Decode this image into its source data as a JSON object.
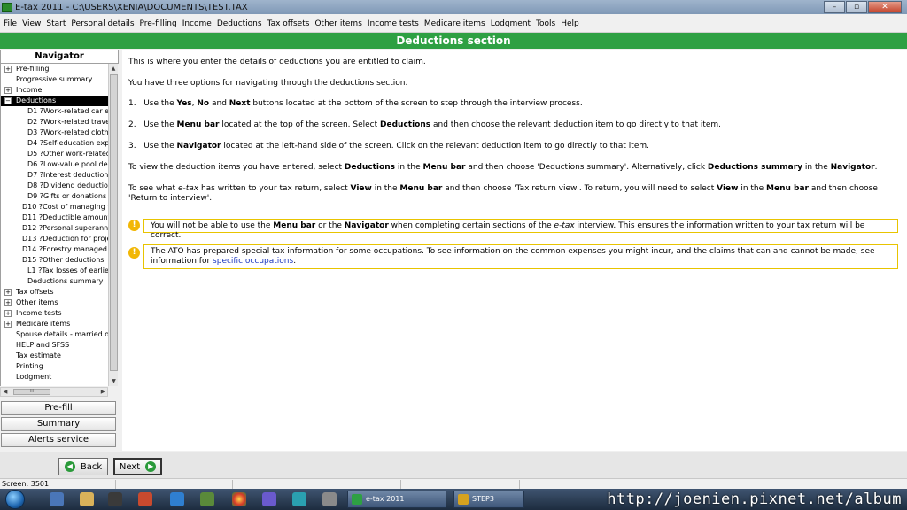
{
  "window": {
    "title": "E-tax 2011 - C:\\USERS\\XENIA\\DOCUMENTS\\TEST.TAX",
    "minimize": "–",
    "maximize": "▫",
    "close": "✕"
  },
  "menu": [
    "File",
    "View",
    "Start",
    "Personal details",
    "Pre-filling",
    "Income",
    "Deductions",
    "Tax offsets",
    "Other items",
    "Income tests",
    "Medicare items",
    "Lodgment",
    "Tools",
    "Help"
  ],
  "section": {
    "title": "Deductions section"
  },
  "navigator": {
    "title": "Navigator",
    "items": [
      {
        "label": "Pre-filling",
        "expander": "+"
      },
      {
        "label": "Progressive summary",
        "expander": ""
      },
      {
        "label": "Income",
        "expander": "+"
      },
      {
        "label": "Deductions",
        "expander": "−",
        "selected": true
      },
      {
        "label": "D1 ?Work-related car exp",
        "expander": ""
      },
      {
        "label": "D2 ?Work-related travel e",
        "expander": ""
      },
      {
        "label": "D3 ?Work-related clothing",
        "expander": ""
      },
      {
        "label": "D4 ?Self-education exper",
        "expander": ""
      },
      {
        "label": "D5 ?Other work-related e",
        "expander": ""
      },
      {
        "label": "D6 ?Low-value pool dedu",
        "expander": ""
      },
      {
        "label": "D7 ?Interest deductions",
        "expander": ""
      },
      {
        "label": "D8 ?Dividend deductions",
        "expander": ""
      },
      {
        "label": "D9 ?Gifts or donations",
        "expander": ""
      },
      {
        "label": "D10 ?Cost of managing tax",
        "expander": ""
      },
      {
        "label": "D11 ?Deductible amount o",
        "expander": ""
      },
      {
        "label": "D12 ?Personal superannu",
        "expander": ""
      },
      {
        "label": "D13 ?Deduction for project",
        "expander": ""
      },
      {
        "label": "D14 ?Forestry managed in",
        "expander": ""
      },
      {
        "label": "D15 ?Other deductions",
        "expander": ""
      },
      {
        "label": "L1 ?Tax losses of earlier",
        "expander": ""
      },
      {
        "label": "Deductions summary",
        "expander": ""
      },
      {
        "label": "Tax offsets",
        "expander": "+"
      },
      {
        "label": "Other items",
        "expander": "+"
      },
      {
        "label": "Income tests",
        "expander": "+"
      },
      {
        "label": "Medicare items",
        "expander": "+"
      },
      {
        "label": "Spouse details - married or d",
        "expander": ""
      },
      {
        "label": "HELP and SFSS",
        "expander": ""
      },
      {
        "label": "Tax estimate",
        "expander": ""
      },
      {
        "label": "Printing",
        "expander": ""
      },
      {
        "label": "Lodgment",
        "expander": ""
      }
    ],
    "scroll_up": "▲",
    "scroll_down": "▼",
    "scroll_left": "◀",
    "scroll_right": "▶",
    "hthumb": "III",
    "buttons": {
      "prefill": "Pre-fill",
      "summary": "Summary",
      "alerts": "Alerts service"
    }
  },
  "content": {
    "intro1": "This is where you enter the details of deductions you are entitled to claim.",
    "intro2": "You have three options for navigating through the deductions section.",
    "opt1": {
      "num": "1.",
      "a": "Use the ",
      "b1": "Yes",
      "c": ", ",
      "b2": "No",
      "d": " and ",
      "b3": "Next",
      "e": " buttons located at the bottom of the screen to step through the interview process."
    },
    "opt2": {
      "num": "2.",
      "a": "Use the ",
      "b1": "Menu bar",
      "c": " located at the top of the screen. Select ",
      "b2": "Deductions",
      "d": " and then choose the relevant deduction item to go directly to that item."
    },
    "opt3": {
      "num": "3.",
      "a": "Use the ",
      "b1": "Navigator",
      "c": " located at the left-hand side of the screen. Click on the relevant deduction item to go directly to that item."
    },
    "view": {
      "a": "To view the deduction items you have entered, select ",
      "b1": "Deductions",
      "c": " in the ",
      "b2": "Menu bar",
      "d": " and then choose 'Deductions summary'. Alternatively, click ",
      "b3": "Deductions summary",
      "e": " in the ",
      "b4": "Navigator",
      "f": "."
    },
    "see": {
      "a": "To see what ",
      "i1": "e-tax",
      "b": " has written to your tax return, select ",
      "b1": "View",
      "c": " in the ",
      "b2": "Menu bar",
      "d": " and then choose 'Tax return view'. To return, you will need to select ",
      "b3": "View",
      "e": " in the ",
      "b4": "Menu bar",
      "f": " and then choose 'Return to interview'."
    },
    "alert1": {
      "a": "You will not be able to use the ",
      "b1": "Menu bar",
      "c": " or the ",
      "b2": "Navigator",
      "d": " when completing certain sections of the ",
      "i1": "e-tax",
      "e": " interview. This ensures the information written to your tax return will be correct."
    },
    "alert2": {
      "a": "The ATO has prepared special tax information for some occupations. To see information on the common expenses you might incur, and the claims that can and cannot be made, see information for ",
      "link": "specific occupations",
      "b": "."
    },
    "alert_icon": "!"
  },
  "bottom": {
    "back": "Back",
    "next": "Next",
    "back_arrow": "◀",
    "next_arrow": "▶"
  },
  "status": {
    "screen": "Screen: 3501"
  },
  "taskbar": {
    "tasks": [
      "e-tax 2011",
      "STEP3"
    ]
  },
  "watermark": "http://joenien.pixnet.net/album"
}
